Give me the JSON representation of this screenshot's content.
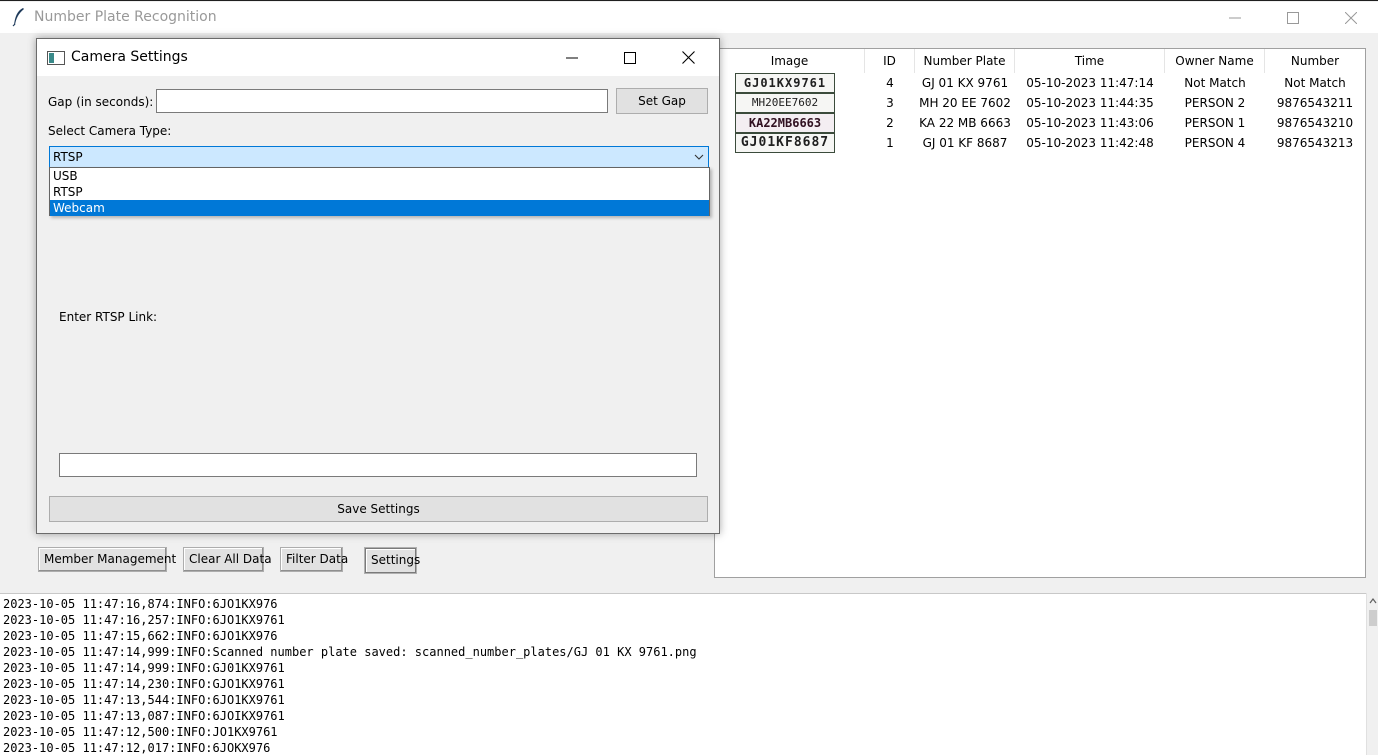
{
  "window": {
    "title": "Number Plate Recognition"
  },
  "table": {
    "columns": [
      "Image",
      "ID",
      "Number Plate",
      "Time",
      "Owner Name",
      "Number"
    ],
    "rows": [
      {
        "plate_image_text": "GJ01KX9761",
        "id": "4",
        "plate": "GJ 01 KX 9761",
        "time": "05-10-2023 11:47:14",
        "owner": "Not Match",
        "number": "Not Match"
      },
      {
        "plate_image_text": "MH20EE7602",
        "id": "3",
        "plate": "MH 20 EE 7602",
        "time": "05-10-2023 11:44:35",
        "owner": "PERSON  2",
        "number": "9876543211"
      },
      {
        "plate_image_text": "KA22MB6663",
        "id": "2",
        "plate": "KA 22 MB 6663",
        "time": "05-10-2023 11:43:06",
        "owner": "PERSON  1",
        "number": "9876543210"
      },
      {
        "plate_image_text": "GJ01KF8687",
        "id": "1",
        "plate": "GJ 01 KF 8687",
        "time": "05-10-2023 11:42:48",
        "owner": "PERSON  4",
        "number": "9876543213"
      }
    ]
  },
  "buttons": {
    "member_management": "Member Management",
    "clear_all": "Clear All Data",
    "filter": "Filter Data",
    "settings": "Settings"
  },
  "log": {
    "lines": [
      "2023-10-05 11:47:16,874:INFO:6JO1KX976",
      "2023-10-05 11:47:16,257:INFO:6JO1KX9761",
      "2023-10-05 11:47:15,662:INFO:6JO1KX976",
      "2023-10-05 11:47:14,999:INFO:Scanned number plate saved: scanned_number_plates/GJ 01 KX 9761.png",
      "2023-10-05 11:47:14,999:INFO:GJ01KX9761",
      "2023-10-05 11:47:14,230:INFO:GJO1KX9761",
      "2023-10-05 11:47:13,544:INFO:6JO1KX9761",
      "2023-10-05 11:47:13,087:INFO:6JOIKX9761",
      "2023-10-05 11:47:12,500:INFO:JO1KX9761",
      "2023-10-05 11:47:12,017:INFO:6JOKX976"
    ]
  },
  "dialog": {
    "title": "Camera Settings",
    "gap_label": "Gap (in seconds):",
    "gap_value": "",
    "set_gap_button": "Set Gap",
    "camera_type_label": "Select Camera Type:",
    "camera_type_value": "RTSP",
    "camera_options": [
      "USB",
      "RTSP",
      "Webcam"
    ],
    "highlighted_option": "Webcam",
    "rtsp_label": "Enter RTSP Link:",
    "rtsp_value": "",
    "save_button": "Save Settings"
  },
  "colors": {
    "accent": "#0078d7",
    "combo_bg": "#cce8ff",
    "title_inactive": "#999999"
  },
  "icons": [
    "feather-icon",
    "minimize-icon",
    "maximize-icon",
    "close-icon",
    "window-icon",
    "chevron-down-icon"
  ]
}
